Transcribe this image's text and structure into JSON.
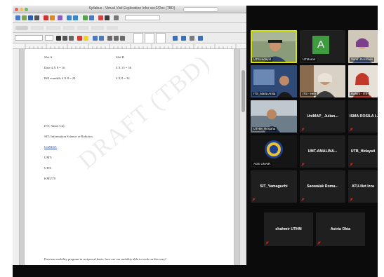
{
  "word": {
    "title": "Syllabus - Virtual Visit Exploration Infor sec2/Doc (TBD)"
  },
  "document": {
    "lines": [
      "Slot A",
      "Slot B",
      "Date 4 X 8 = 16",
      "4 X 13 = 56",
      "Bill scandals 4 X 8 = 24",
      "4 X 8 = 32",
      "ITS: Smart City",
      "SIT: Information Science or Robotics",
      "UniMAP:",
      "UMT:",
      "UTH:",
      "KMUTT:",
      "Previous mobility program in reciprocal basis; how are our mobility able to work on this way?"
    ],
    "watermark": "DRAFT (TBD)"
  },
  "zoom": {
    "tiles": [
      {
        "id": "t1",
        "type": "video",
        "label": "UTS-Hidayat",
        "active": true
      },
      {
        "id": "t2",
        "type": "avatar",
        "initial": "A",
        "label": "UTM-ann",
        "color": "#3f9b3f"
      },
      {
        "id": "t3",
        "type": "video",
        "label": "Sarah Rosmaini"
      },
      {
        "id": "t4",
        "type": "video",
        "label": "ITS_Maria Anita"
      },
      {
        "id": "t5",
        "type": "video",
        "label": "ITS - Hen"
      },
      {
        "id": "t6",
        "type": "video",
        "label": "Rahmi - ITS"
      },
      {
        "id": "t7",
        "type": "video",
        "label": "UTHM_Rosjaha"
      },
      {
        "id": "t8",
        "type": "name",
        "name": "UniMAP_ Julian..."
      },
      {
        "id": "t9",
        "type": "name",
        "name": "ISMA ROSILA I..."
      },
      {
        "id": "t10",
        "type": "logo",
        "label": "AGE UNAIR"
      },
      {
        "id": "t11",
        "type": "name",
        "name": "UMT-AMALINA..."
      },
      {
        "id": "t12",
        "type": "name",
        "name": "UTB_Hidayati"
      },
      {
        "id": "t13",
        "type": "name",
        "name": "SIT_Yamaguchi"
      },
      {
        "id": "t14",
        "type": "name",
        "name": "Saowalak Roma..."
      },
      {
        "id": "t15",
        "type": "name",
        "name": "ATU-Net Izza"
      },
      {
        "id": "t16",
        "type": "name",
        "name": "shahmir UTHM"
      },
      {
        "id": "t17",
        "type": "name",
        "name": "Astria Okta"
      }
    ]
  }
}
